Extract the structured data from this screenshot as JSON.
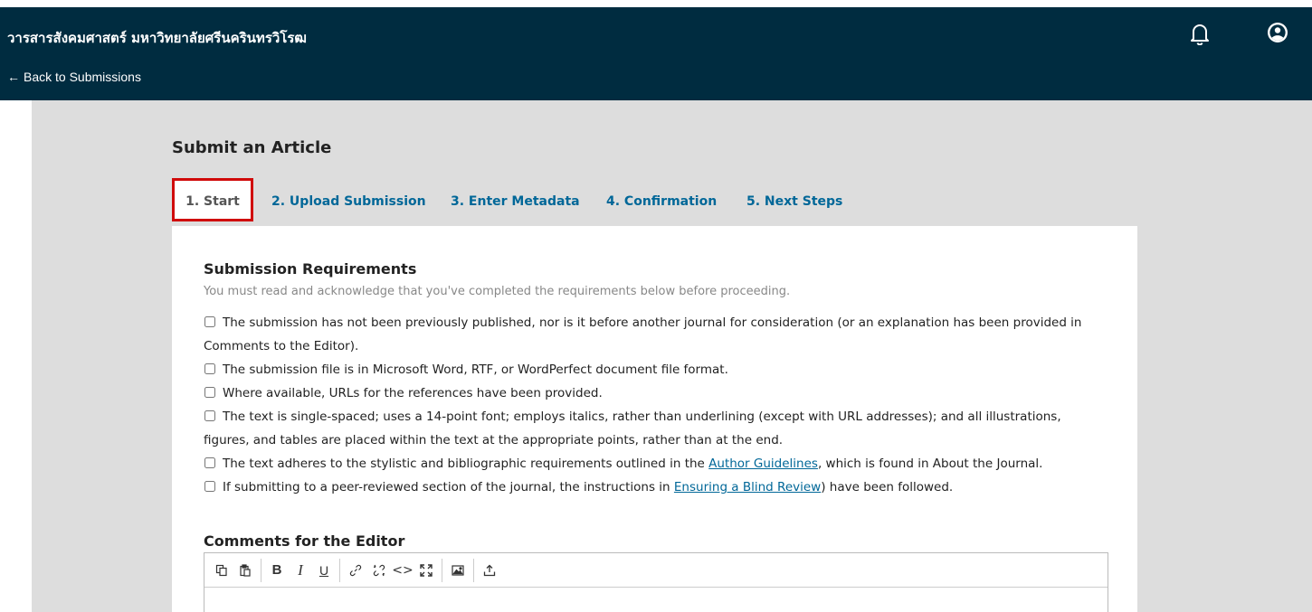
{
  "header": {
    "site_title": "วารสารสังคมศาสตร์ มหาวิทยาลัยศรีนครินทรวิโรฒ",
    "back_arrow": "←",
    "back_label": "Back to Submissions"
  },
  "page": {
    "title": "Submit an Article"
  },
  "tabs": [
    {
      "label": "1. Start",
      "active": true
    },
    {
      "label": "2. Upload Submission"
    },
    {
      "label": "3. Enter Metadata"
    },
    {
      "label": "4. Confirmation"
    },
    {
      "label": "5. Next Steps"
    }
  ],
  "requirements": {
    "title": "Submission Requirements",
    "help": "You must read and acknowledge that you've completed the requirements below before proceeding.",
    "items": [
      {
        "text": "The submission has not been previously published, nor is it before another journal for consideration (or an explanation has been provided in Comments to the Editor)."
      },
      {
        "text": "The submission file is in Microsoft Word, RTF, or WordPerfect document file format."
      },
      {
        "text": "Where available, URLs for the references have been provided."
      },
      {
        "text": "The text is single-spaced; uses a 14-point font; employs italics, rather than underlining (except with URL addresses); and all illustrations, figures, and tables are placed within the text at the appropriate points, rather than at the end."
      },
      {
        "before": "The text adheres to the stylistic and bibliographic requirements outlined in the ",
        "link": "Author Guidelines",
        "after": ", which is found in About the Journal."
      },
      {
        "before": "If submitting to a peer-reviewed section of the journal, the instructions in ",
        "link": "Ensuring a Blind Review",
        "after": ") have been followed."
      }
    ]
  },
  "comments": {
    "title": "Comments for the Editor",
    "toolbar": {
      "bold": "B",
      "italic": "I",
      "underline": "U",
      "code": "<>",
      "icons": [
        "copy-icon",
        "paste-icon",
        "link-icon",
        "unlink-icon",
        "fullscreen-icon",
        "image-icon",
        "upload-icon"
      ]
    }
  },
  "colors": {
    "header_bg": "#002c40",
    "link": "#006798",
    "canvas_bg": "#dddddd",
    "active_tab_border": "#d00a0a"
  }
}
